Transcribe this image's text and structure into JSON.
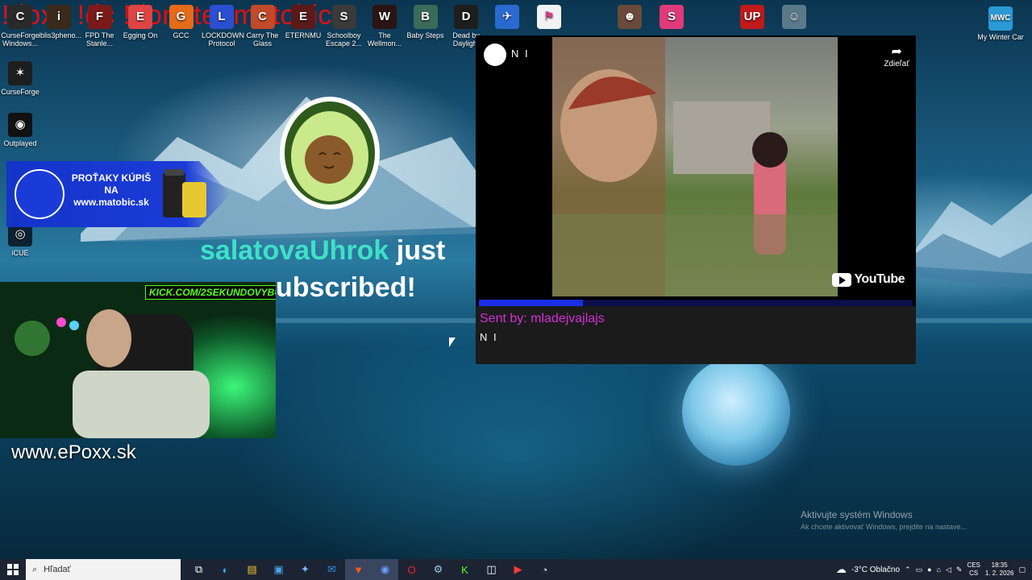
{
  "banner": {
    "text": "!doxx !dc !donate !matobic"
  },
  "desktop_icons_left": [
    {
      "label": "CurseForge Windows...",
      "color": "#2a2a2a",
      "glyph": "C"
    },
    {
      "label": "CurseForge",
      "color": "#1e1e1e",
      "glyph": "✶"
    },
    {
      "label": "Outplayed",
      "color": "#111111",
      "glyph": "◉"
    },
    {
      "label": "iCUE",
      "color": "#0d2230",
      "glyph": "◎"
    }
  ],
  "desktop_icons_top": [
    {
      "label": "iblis3pheno...",
      "color": "#3a2a1a",
      "glyph": "i"
    },
    {
      "label": "FPD The Stanle...",
      "color": "#7a1a1a",
      "glyph": "F"
    },
    {
      "label": "Egging On",
      "color": "#d44",
      "glyph": "E"
    },
    {
      "label": "GCC",
      "color": "#e56a1a",
      "glyph": "G"
    },
    {
      "label": "LOCKDOWN Protocol",
      "color": "#2a4fd0",
      "glyph": "L"
    },
    {
      "label": "Carry The Glass",
      "color": "#c04a2a",
      "glyph": "C"
    },
    {
      "label": "ETERNMU",
      "color": "#5a1a1a",
      "glyph": "E"
    },
    {
      "label": "Schoolboy Escape 2...",
      "color": "#3a3a3a",
      "glyph": "S"
    },
    {
      "label": "The Wellmon...",
      "color": "#2a1414",
      "glyph": "W"
    },
    {
      "label": "Baby Steps",
      "color": "#3a6a5a",
      "glyph": "B"
    },
    {
      "label": "Dead by Daylight",
      "color": "#1e1e1e",
      "glyph": "D"
    }
  ],
  "desktop_icons_top_right": [
    {
      "label": "",
      "color": "#2a6ad0",
      "glyph": "✈"
    },
    {
      "label": "",
      "color": "#f2f2f2",
      "glyph": "⚑"
    },
    {
      "label": "",
      "color": "#6a4a3a",
      "glyph": "☻"
    },
    {
      "label": "",
      "color": "#e03a7a",
      "glyph": "S"
    },
    {
      "label": "",
      "color": "#c01a1a",
      "glyph": "UP"
    },
    {
      "label": "",
      "color": "#5a7a8a",
      "glyph": "☺"
    }
  ],
  "desktop_icon_corner": {
    "label": "My Winter Car",
    "glyph": "MWC"
  },
  "promo": {
    "line1": "PROŤAKY KÚPIŠ",
    "line2": "NA",
    "line3": "www.matobic.sk"
  },
  "subscriber": {
    "username": "salatovaUhrok",
    "suffix": "just",
    "line2": "ubscribed!"
  },
  "webcam": {
    "badge": "KICK.COM/2SEKUNDOVYBULO"
  },
  "site_text": "www.ePoxx.sk",
  "media": {
    "video_title": "N I",
    "share_label": "Zdieľať",
    "youtube_label": "YouTube",
    "progress": 0.24,
    "sent_by": "Sent by: mladejvajlajs",
    "message": "N I"
  },
  "activation": {
    "title": "Aktivujte systém Windows",
    "subtitle": "Ak chcete aktivovať Windows, prejdite na nastave..."
  },
  "taskbar": {
    "search_placeholder": "Hľadať",
    "apps": [
      {
        "name": "task-view",
        "glyph": "⧉",
        "color": "#ffffff"
      },
      {
        "name": "edge",
        "glyph": "◐",
        "color": "#2fb5e8"
      },
      {
        "name": "explorer",
        "glyph": "▤",
        "color": "#f2c233"
      },
      {
        "name": "store",
        "glyph": "▣",
        "color": "#4aa3e8"
      },
      {
        "name": "copilot",
        "glyph": "✦",
        "color": "#7ab8ff"
      },
      {
        "name": "outlook",
        "glyph": "✉",
        "color": "#2f8be8"
      },
      {
        "name": "brave",
        "glyph": "▼",
        "color": "#ff5a1f"
      },
      {
        "name": "browser",
        "glyph": "◉",
        "color": "#6aa0ff"
      },
      {
        "name": "opera",
        "glyph": "O",
        "color": "#ff1b2d"
      },
      {
        "name": "steam",
        "glyph": "⚙",
        "color": "#9fc6e8"
      },
      {
        "name": "kick",
        "glyph": "K",
        "color": "#53fc18"
      },
      {
        "name": "capcut",
        "glyph": "◫",
        "color": "#ffffff"
      },
      {
        "name": "streamlabs",
        "glyph": "▶",
        "color": "#ff3b3b"
      },
      {
        "name": "obs",
        "glyph": "◔",
        "color": "#dddddd"
      }
    ],
    "weather": "-3°C Oblačno",
    "lang_top": "CES",
    "lang_bottom": "CS",
    "time": "18:35",
    "date": "1. 2. 2026"
  }
}
